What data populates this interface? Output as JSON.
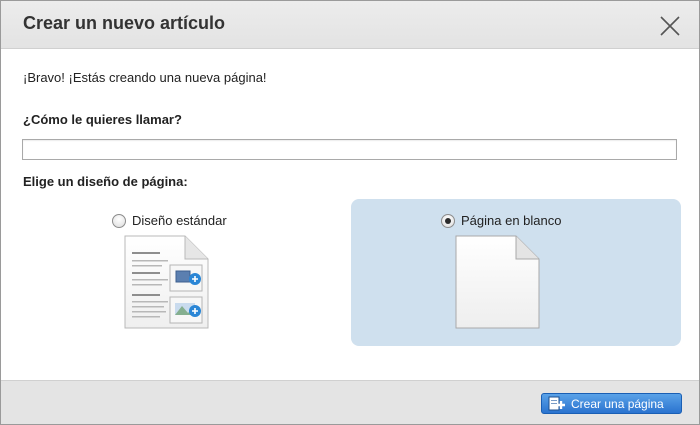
{
  "dialog": {
    "title": "Crear un nuevo artículo",
    "close_icon": "close-icon"
  },
  "form": {
    "intro": "¡Bravo! ¡Estás creando una nueva página!",
    "name_label": "¿Cómo le quieres llamar?",
    "name_value": "",
    "name_placeholder": "",
    "layout_label": "Elige un diseño de página:"
  },
  "layouts": [
    {
      "label": "Diseño estándar",
      "selected": false,
      "icon": "standard-layout-icon"
    },
    {
      "label": "Página en blanco",
      "selected": true,
      "icon": "blank-page-icon"
    }
  ],
  "footer": {
    "create_label": "Crear una página",
    "create_icon": "add-page-icon"
  },
  "colors": {
    "header_bg": "#e6e6e6",
    "selected_option_bg": "#cfe0ee",
    "primary_button": "#2a73cf"
  }
}
